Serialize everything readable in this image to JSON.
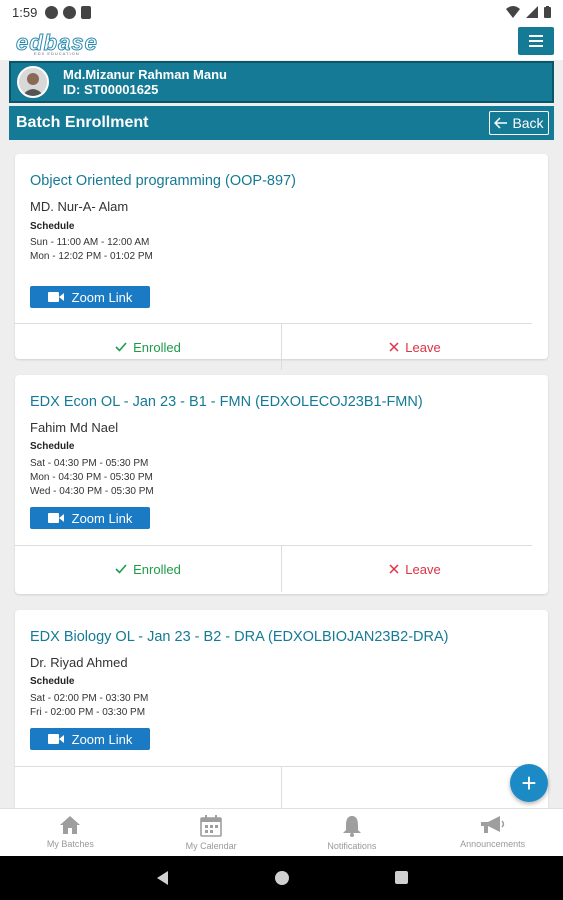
{
  "status_bar": {
    "time": "1:59"
  },
  "logo": {
    "text": "edbase",
    "subtitle": "EDX EDUCATION"
  },
  "profile": {
    "name": "Md.Mizanur Rahman Manu",
    "id_text": "ID: ST00001625"
  },
  "page": {
    "title": "Batch Enrollment",
    "back_label": "Back"
  },
  "batches": [
    {
      "title": "Object Oriented programming (OOP-897)",
      "instructor": "MD. Nur-A- Alam",
      "schedule_label": "Schedule",
      "schedule": [
        "Sun - 11:00 AM - 12:00 AM",
        "Mon - 12:02 PM - 01:02 PM"
      ],
      "zoom_label": "Zoom Link",
      "enrolled_label": "Enrolled",
      "leave_label": "Leave"
    },
    {
      "title": "EDX Econ OL - Jan 23 - B1 - FMN (EDXOLECOJ23B1-FMN)",
      "instructor": "Fahim Md Nael",
      "schedule_label": "Schedule",
      "schedule": [
        "Sat - 04:30 PM - 05:30 PM",
        "Mon - 04:30 PM - 05:30 PM",
        "Wed - 04:30 PM - 05:30 PM"
      ],
      "zoom_label": "Zoom Link",
      "enrolled_label": "Enrolled",
      "leave_label": "Leave"
    },
    {
      "title": "EDX Biology OL - Jan 23 - B2 - DRA (EDXOLBIOJAN23B2-DRA)",
      "instructor": "Dr. Riyad Ahmed",
      "schedule_label": "Schedule",
      "schedule": [
        "Sat - 02:00 PM - 03:30 PM",
        "Fri - 02:00 PM - 03:30 PM"
      ],
      "zoom_label": "Zoom Link"
    }
  ],
  "fab": {
    "icon": "plus-icon",
    "label": "+"
  },
  "bottom_nav": [
    {
      "label": "My Batches",
      "icon": "home-icon"
    },
    {
      "label": "My Calendar",
      "icon": "calendar-icon"
    },
    {
      "label": "Notifications",
      "icon": "bell-icon"
    },
    {
      "label": "Announcements",
      "icon": "megaphone-icon"
    }
  ],
  "colors": {
    "primary": "#157a95",
    "zoom": "#1a7ac4",
    "enrolled": "#1e9b49",
    "leave": "#dd3344",
    "fab": "#1c8bc5"
  }
}
